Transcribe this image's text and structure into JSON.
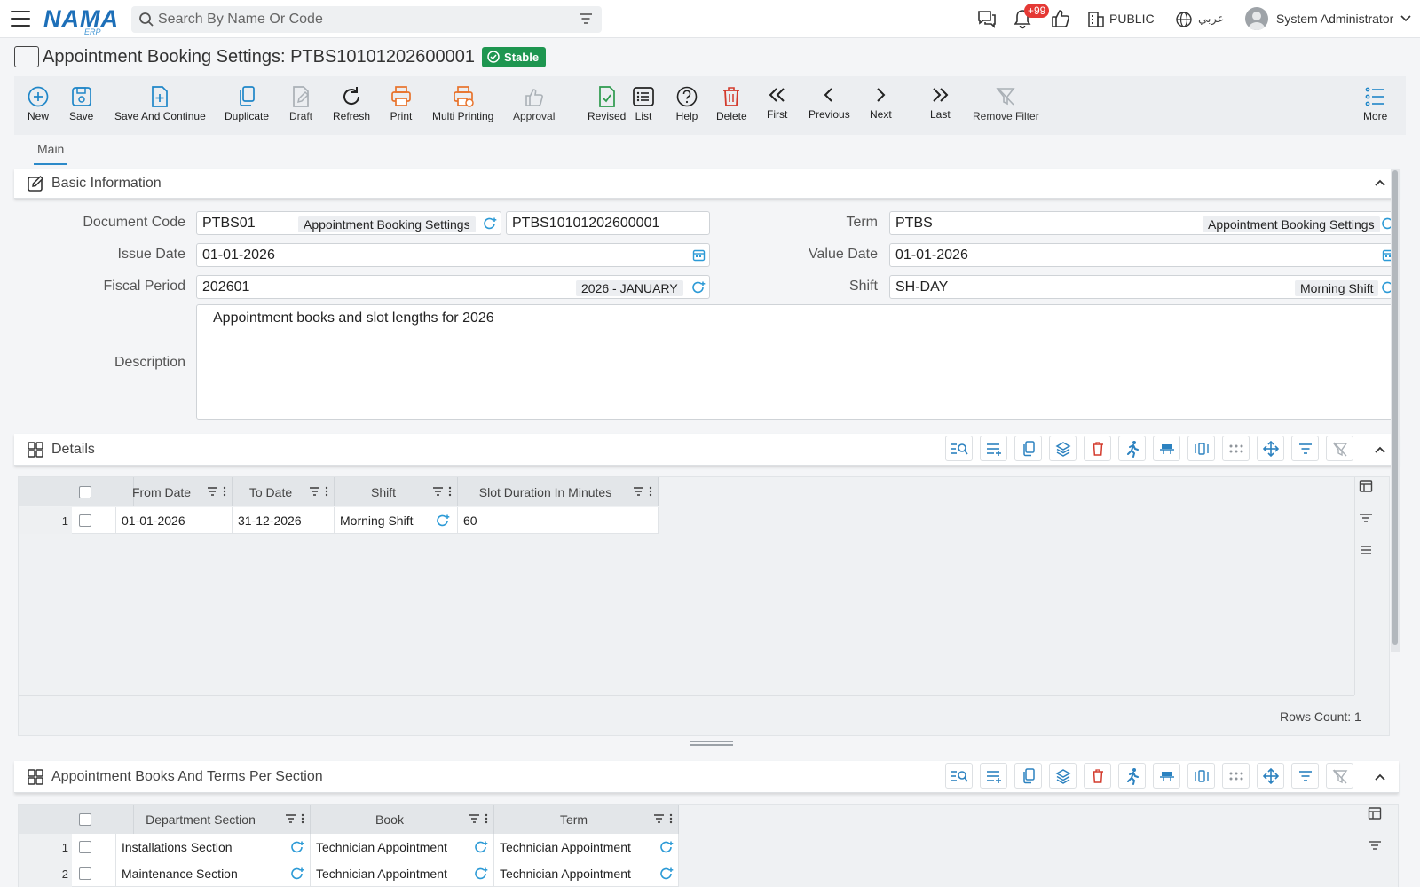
{
  "app": {
    "logo": "NAMA",
    "logo_sub": "ERP",
    "search_placeholder": "Search By Name Or Code",
    "notif_count": "+99",
    "company": "PUBLIC",
    "language": "عربي",
    "user": "System Administrator"
  },
  "page": {
    "title": "Appointment Booking Settings: PTBS10101202600001",
    "status": "Stable"
  },
  "toolbar": {
    "items": [
      {
        "label": "New",
        "icon": "plus-circle-icon"
      },
      {
        "label": "Save",
        "icon": "save-icon"
      },
      {
        "label": "Save And Continue",
        "icon": "save-continue-icon"
      },
      {
        "label": "Duplicate",
        "icon": "duplicate-icon"
      },
      {
        "label": "Draft",
        "icon": "draft-icon"
      },
      {
        "label": "Refresh",
        "icon": "refresh-icon"
      },
      {
        "label": "Print",
        "icon": "print-icon"
      },
      {
        "label": "Multi Printing",
        "icon": "multi-print-icon"
      },
      {
        "label": "Approval",
        "icon": "thumbs-up-icon"
      },
      {
        "label": "Revised",
        "icon": "revised-icon"
      },
      {
        "label": "List",
        "icon": "list-icon"
      },
      {
        "label": "Help",
        "icon": "help-icon"
      },
      {
        "label": "Delete",
        "icon": "trash-icon"
      },
      {
        "label": "First",
        "icon": "double-chevron-left-icon"
      },
      {
        "label": "Previous",
        "icon": "chevron-left-icon"
      },
      {
        "label": "Next",
        "icon": "chevron-right-icon"
      },
      {
        "label": "Last",
        "icon": "double-chevron-right-icon"
      },
      {
        "label": "Remove Filter",
        "icon": "remove-filter-icon"
      },
      {
        "label": "More",
        "icon": "more-list-icon"
      }
    ]
  },
  "tabs": {
    "main": "Main"
  },
  "basic": {
    "title": "Basic Information",
    "document_code": {
      "label": "Document Code",
      "value": "PTBS01",
      "chip": "Appointment Booking Settings",
      "number": "PTBS10101202600001"
    },
    "term": {
      "label": "Term",
      "value": "PTBS",
      "chip": "Appointment Booking Settings"
    },
    "issue_date": {
      "label": "Issue Date",
      "value": "01-01-2026"
    },
    "value_date": {
      "label": "Value Date",
      "value": "01-01-2026"
    },
    "fiscal_period": {
      "label": "Fiscal Period",
      "value": "202601",
      "chip": "2026 - JANUARY"
    },
    "shift": {
      "label": "Shift",
      "value": "SH-DAY",
      "chip": "Morning Shift"
    },
    "description": {
      "label": "Description",
      "value": "Appointment books and slot lengths for 2026"
    }
  },
  "details": {
    "title": "Details",
    "columns": [
      "From Date",
      "To Date",
      "Shift",
      "Slot Duration In Minutes"
    ],
    "rows": [
      {
        "num": "1",
        "from": "01-01-2026",
        "to": "31-12-2026",
        "shift": "Morning Shift",
        "slot": "60"
      }
    ],
    "rows_count": "Rows Count: 1"
  },
  "books": {
    "title": "Appointment Books And Terms Per Section",
    "columns": [
      "Department Section",
      "Book",
      "Term"
    ],
    "rows": [
      {
        "num": "1",
        "section": "Installations Section",
        "book": "Technician Appointment",
        "term": "Technician Appointment"
      },
      {
        "num": "2",
        "section": "Maintenance Section",
        "book": "Technician Appointment",
        "term": "Technician Appointment"
      }
    ]
  }
}
